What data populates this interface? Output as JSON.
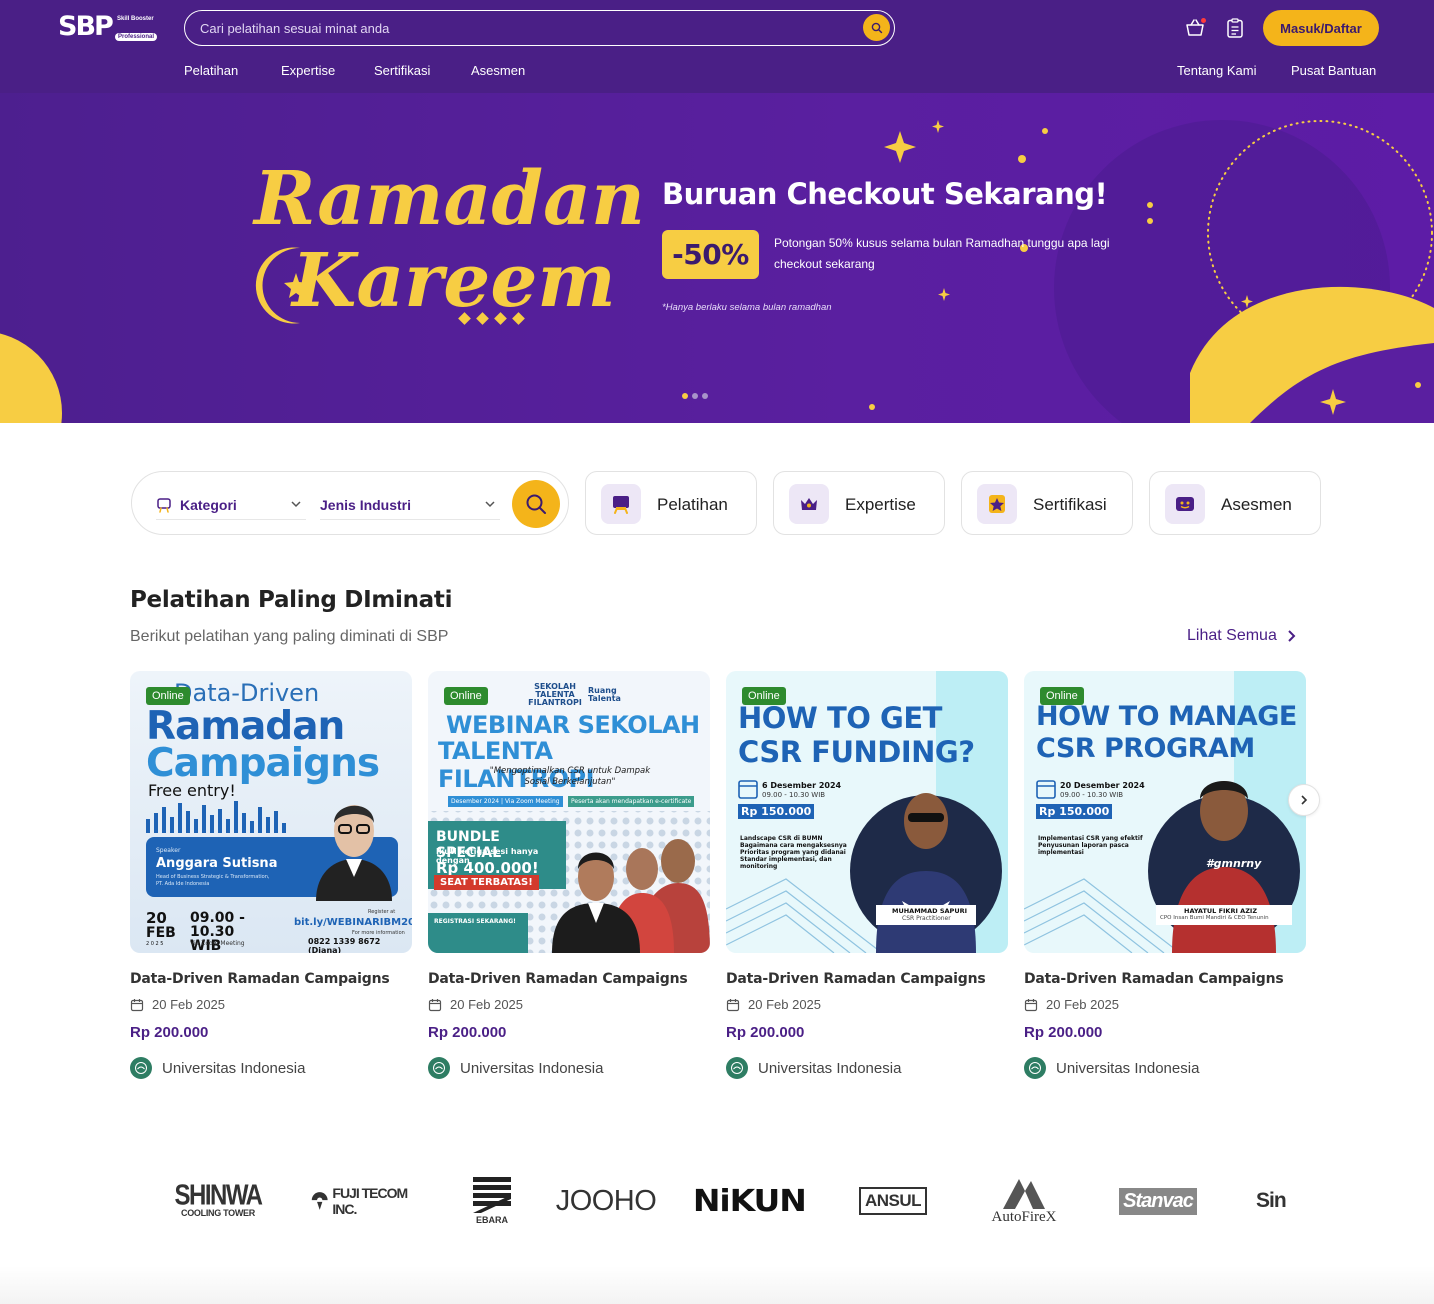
{
  "header": {
    "logo_main": "SBP",
    "logo_sub": "Skill Booster",
    "logo_pro": "Professional",
    "search_placeholder": "Cari pelatihan sesuai minat anda",
    "login_label": "Masuk/Daftar",
    "nav_left": [
      "Pelatihan",
      "Expertise",
      "Sertifikasi",
      "Asesmen"
    ],
    "nav_right": [
      "Tentang Kami",
      "Pusat Bantuan"
    ]
  },
  "banner": {
    "title_line1": "Ramadan",
    "title_line2": "Kareem",
    "headline": "Buruan Checkout Sekarang!",
    "discount": "-50%",
    "description": "Potongan 50% kusus selama bulan Ramadhan tunggu apa lagi checkout sekarang",
    "note": "*Hanya berlaku selama bulan ramadhan",
    "slide_count": 3,
    "active_slide": 1
  },
  "filters": {
    "kategori": "Kategori",
    "industri": "Jenis Industri",
    "categories": [
      "Pelatihan",
      "Expertise",
      "Sertifikasi",
      "Asesmen"
    ]
  },
  "section": {
    "title": "Pelatihan Paling DIminati",
    "subtitle": "Berikut pelatihan yang paling diminati di SBP",
    "see_all": "Lihat Semua"
  },
  "cards": [
    {
      "badge": "Online",
      "title": "Data-Driven Ramadan Campaigns",
      "date": "20 Feb 2025",
      "price": "Rp 200.000",
      "institution": "Universitas Indonesia",
      "art": {
        "l1": "Data-Driven",
        "l2": "Ramadan",
        "l3": "Campaigns",
        "free": "Free entry!",
        "speaker_label": "Speaker",
        "speaker": "Anggara Sutisna",
        "speaker_role": "Head of Business Strategic & Transformation, PT. Ada Ide Indonesia",
        "day": "20",
        "month": "FEB",
        "year": "2 0 2 5",
        "time": "09.00 - 10.30 WIB",
        "via": "Via Zoom Meeting",
        "reg_label": "Register at",
        "link": "bit.ly/WEBINARIBM2025",
        "info_label": "For more information",
        "phone": "0822 1339 8672 (Diana)"
      }
    },
    {
      "badge": "Online",
      "title": "Data-Driven Ramadan Campaigns",
      "date": "20 Feb 2025",
      "price": "Rp 200.000",
      "institution": "Universitas Indonesia",
      "art": {
        "brand1": "SEKOLAH TALENTA FILANTROPI",
        "brand2": "Ruang Talenta",
        "l1": "WEBINAR SEKOLAH",
        "l2": "TALENTA FILANTROPI",
        "quote": "\"Mengoptimalkan CSR untuk Dampak Sosial Berkelanjutan\"",
        "tag1": "Desember 2024 | Via Zoom Meeting",
        "tag2": "Peserta akan mendapatkan e-certificate",
        "bundle": "BUNDLE SPECIAL",
        "bundle_sub": "Ikuti ketiga sesi hanya dengan",
        "bundle_price": "Rp 400.000!",
        "seat": "SEAT TERBATAS!",
        "reg": "REGISTRASI SEKARANG!"
      }
    },
    {
      "badge": "Online",
      "title": "Data-Driven Ramadan Campaigns",
      "date": "20 Feb 2025",
      "price": "Rp 200.000",
      "institution": "Universitas Indonesia",
      "art": {
        "l1": "HOW TO GET",
        "l2": "CSR FUNDING?",
        "date": "6 Desember 2024",
        "time": "09.00 - 10.30 WIB",
        "price": "Rp 150.000",
        "points": [
          "Landscape CSR di BUMN",
          "Bagaimana cara mengaksesnya",
          "Prioritas program yang didanai",
          "Standar implementasi, dan monitoring"
        ],
        "person": "MUHAMMAD SAPURI",
        "role": "CSR Practitioner"
      }
    },
    {
      "badge": "Online",
      "title": "Data-Driven Ramadan Campaigns",
      "date": "20 Feb 2025",
      "price": "Rp 200.000",
      "institution": "Universitas Indonesia",
      "art": {
        "l1": "HOW TO MANAGE",
        "l2": "CSR PROGRAM",
        "date": "20 Desember 2024",
        "time": "09.00 - 10.30 WIB",
        "price": "Rp 150.000",
        "points": [
          "Implementasi CSR yang efektif",
          "Penyusunan laporan pasca implementasi"
        ],
        "person": "HAYATUL FIKRI AZIZ",
        "role": "CPO Insan Bumi Mandiri & CEO Tenunin",
        "shirt": "#gmnrny"
      }
    }
  ],
  "partners": {
    "shinwa": "SHINWA",
    "shinwa_sub": "COOLING TOWER",
    "fuji": "FUJI TECOM INC.",
    "ebara": "EBARA",
    "jooho": "JOOHO",
    "nikun": "NiKUN",
    "ansul": "ANSUL",
    "autofirex": "AutoFireX",
    "stanvac": "Stanvac",
    "sin": "Sin"
  },
  "colors": {
    "primary": "#4a1f86",
    "accent": "#f4b41a",
    "banner_yellow": "#f7cd43",
    "online_badge": "#2e8b2e"
  }
}
